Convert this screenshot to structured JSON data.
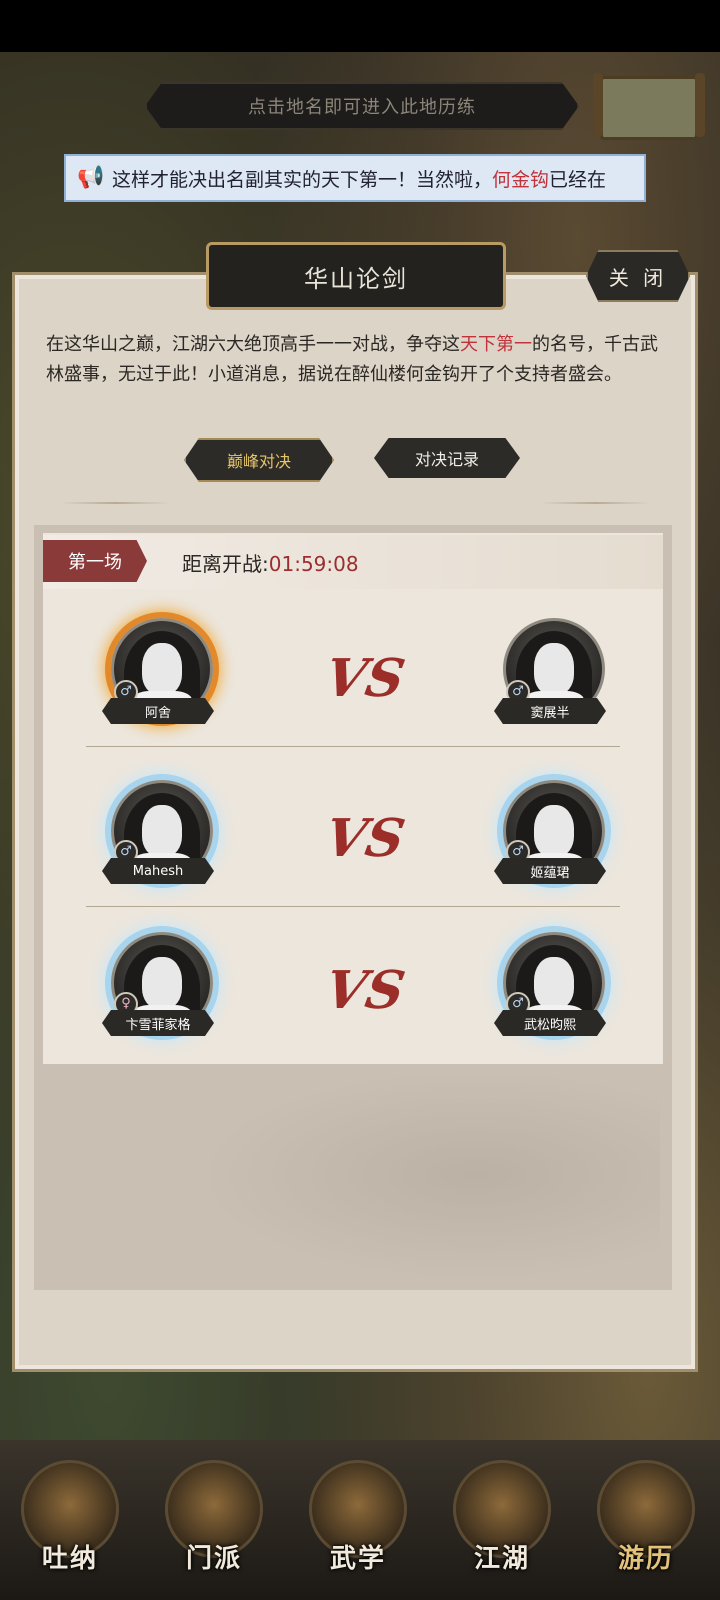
{
  "hint_bar": {
    "text": "点击地名即可进入此地历练"
  },
  "marquee": {
    "text_before": "这样才能决出名副其实的天下第一！当然啦，",
    "highlight": "何金钩",
    "text_after": "已经在"
  },
  "panel": {
    "title": "华山论剑",
    "close_label": "关 闭",
    "description_parts": {
      "p1": "在这华山之巅，江湖六大绝顶高手一一对战，争夺这",
      "red": "天下第一",
      "p2": "的名号，千古武林盛事，无过于此！小道消息，据说在醉仙楼何金钩开了个支持者盛会。"
    },
    "tabs": {
      "active": "巅峰对决",
      "inactive": "对决记录"
    }
  },
  "round": {
    "label": "第一场",
    "countdown_label": "距离开战:",
    "countdown_time": "01:59:08"
  },
  "matches": [
    {
      "left": {
        "name": "阿舍",
        "gender": "♂"
      },
      "vs": "VS",
      "right": {
        "name": "窦展半",
        "gender": "♂"
      }
    },
    {
      "left": {
        "name": "Mahesh",
        "gender": "♂"
      },
      "vs": "VS",
      "right": {
        "name": "姬蕴珺",
        "gender": "♂"
      }
    },
    {
      "left": {
        "name": "卞雪菲家格",
        "gender": "♀"
      },
      "vs": "VS",
      "right": {
        "name": "武松昀熙",
        "gender": "♂"
      }
    }
  ],
  "nav": [
    {
      "label": "吐纳"
    },
    {
      "label": "门派"
    },
    {
      "label": "武学"
    },
    {
      "label": "江湖"
    },
    {
      "label": "游历"
    }
  ]
}
